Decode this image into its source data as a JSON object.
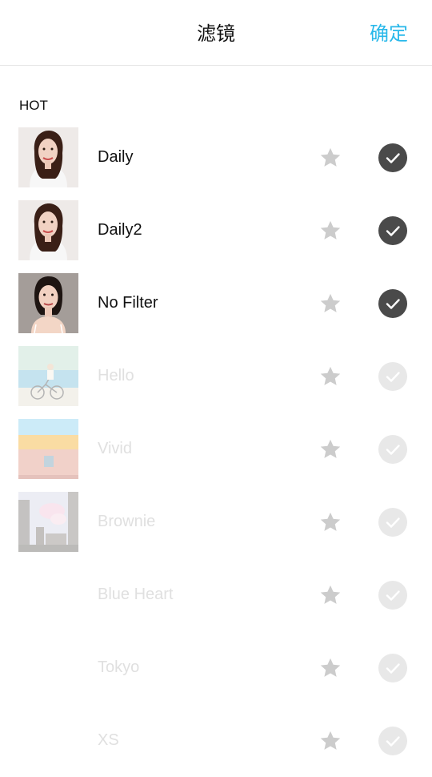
{
  "header": {
    "title": "滤镜",
    "confirm_label": "确定"
  },
  "colors": {
    "accent": "#29b8ea",
    "check_active": "#4a4a4a",
    "check_inactive": "#e8e8e8",
    "star": "#cccccc",
    "inactive_text": "#e0e0e0"
  },
  "section": {
    "label": "HOT"
  },
  "filters": [
    {
      "name": "Daily",
      "enabled": true,
      "thumbnail": "portrait-light"
    },
    {
      "name": "Daily2",
      "enabled": true,
      "thumbnail": "portrait-light"
    },
    {
      "name": "No Filter",
      "enabled": true,
      "thumbnail": "portrait-gray"
    },
    {
      "name": "Hello",
      "enabled": false,
      "thumbnail": "bicycle-seaside"
    },
    {
      "name": "Vivid",
      "enabled": false,
      "thumbnail": "orange-building"
    },
    {
      "name": "Brownie",
      "enabled": false,
      "thumbnail": "city-towers"
    },
    {
      "name": "Blue Heart",
      "enabled": false,
      "thumbnail": ""
    },
    {
      "name": "Tokyo",
      "enabled": false,
      "thumbnail": ""
    },
    {
      "name": "XS",
      "enabled": false,
      "thumbnail": ""
    }
  ]
}
